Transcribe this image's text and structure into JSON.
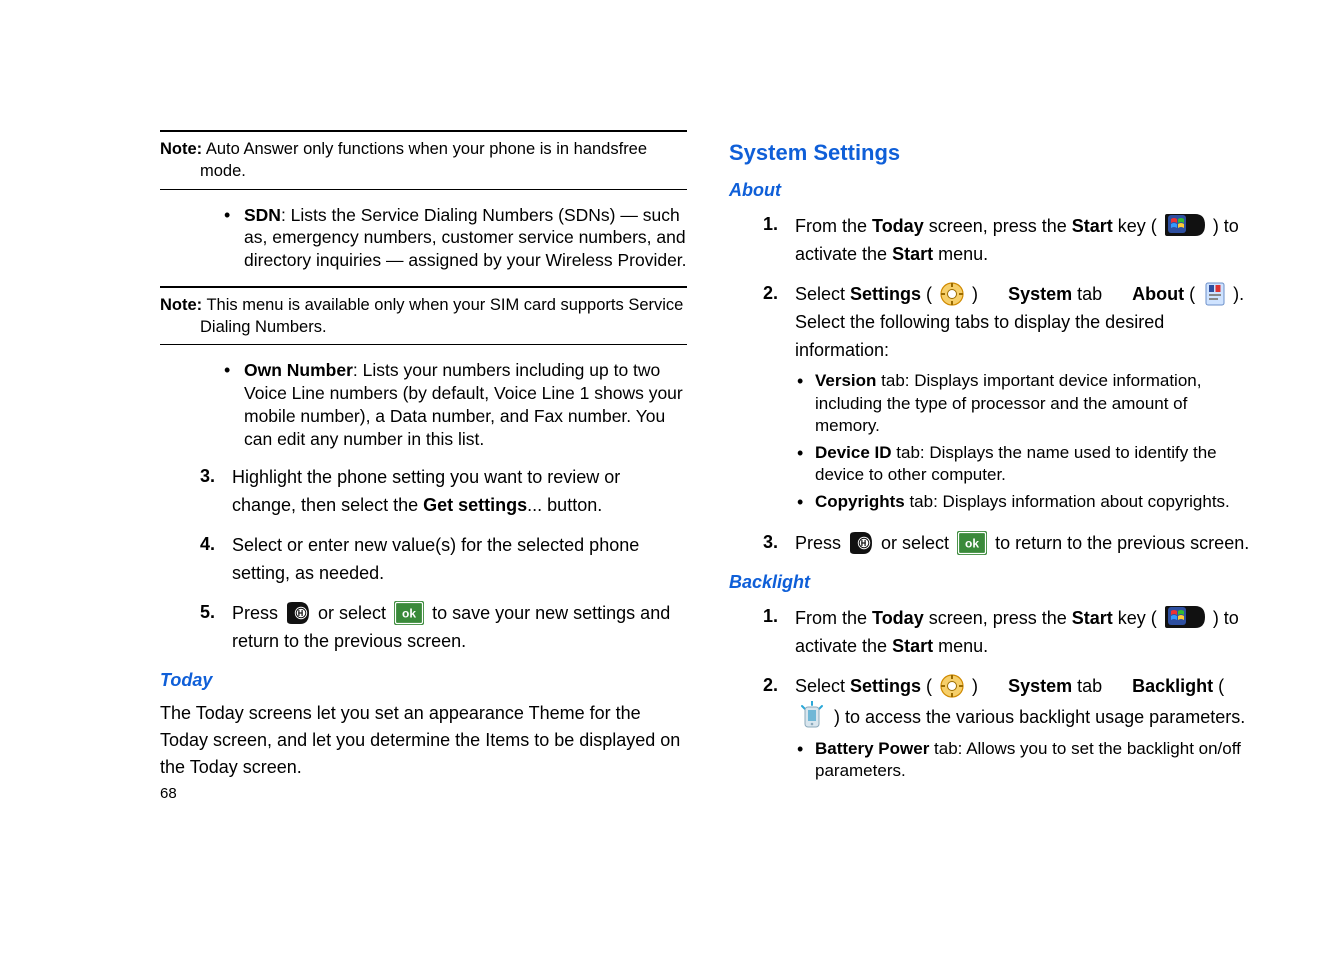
{
  "page_number": "68",
  "left": {
    "note1_label": "Note:",
    "note1_text": " Auto Answer only functions when your phone is in handsfree mode.",
    "bullet_sdn_label": "SDN",
    "bullet_sdn_text": ": Lists the Service Dialing Numbers (SDNs) — such as, emergency numbers, customer service numbers, and directory inquiries — assigned by your Wireless Provider.",
    "note2_label": "Note:",
    "note2_text": " This menu is available only when your SIM card supports Service Dialing Numbers.",
    "bullet_own_label": "Own Number",
    "bullet_own_text": ": Lists your numbers including up to two Voice Line numbers (by default, Voice Line 1 shows your mobile number), a Data number, and Fax number. You can edit any number in this list.",
    "step3_num": "3.",
    "step3_a": "Highlight the phone setting you want to review or change, then select the ",
    "step3_bold": "Get settings",
    "step3_b": "... button.",
    "step4_num": "4.",
    "step4": "Select or enter new value(s) for the selected phone setting, as needed.",
    "step5_num": "5.",
    "step5_a": "Press ",
    "step5_b": " or select ",
    "step5_c": " to save your new settings and return to the previous screen.",
    "today_heading": "Today",
    "today_para": "The Today screens let you set an appearance Theme for the Today screen, and let you determine the Items to be displayed on the Today screen."
  },
  "right": {
    "system_heading": "System Settings",
    "about_heading": "About",
    "a1_num": "1.",
    "a1_a": "From the ",
    "a1_today": "Today",
    "a1_b": " screen, press the ",
    "a1_start": "Start",
    "a1_c": " key ( ",
    "a1_d": " ) to activate the ",
    "a1_startm": "Start",
    "a1_e": " menu.",
    "a2_num": "2.",
    "a2_a": "Select ",
    "a2_settings": "Settings",
    "a2_b": " ( ",
    "a2_c": " )      ",
    "a2_system": "System",
    "a2_d": " tab      ",
    "a2_about": "About",
    "a2_e": " ( ",
    "a2_f": " ). Select the following tabs to display the desired information:",
    "ver_label": "Version",
    "ver_text": " tab: Displays important device information, including the type of processor and the amount of memory.",
    "dev_label": "Device ID",
    "dev_text": " tab: Displays the name used to identify the device to other computer.",
    "cop_label": "Copyrights",
    "cop_text": " tab: Displays information about copyrights.",
    "a3_num": "3.",
    "a3_a": "Press ",
    "a3_b": " or select ",
    "a3_c": " to return to the previous screen.",
    "backlight_heading": "Backlight",
    "b1_num": "1.",
    "b1_a": "From the ",
    "b1_today": "Today",
    "b1_b": " screen, press the ",
    "b1_start": "Start",
    "b1_c": " key ( ",
    "b1_d": " ) to activate the ",
    "b1_startm": "Start",
    "b1_e": " menu.",
    "b2_num": "2.",
    "b2_a": "Select ",
    "b2_settings": "Settings",
    "b2_b": " ( ",
    "b2_c": " )      ",
    "b2_system": "System",
    "b2_d": " tab      ",
    "b2_back": "Backlight",
    "b2_e": " ( ",
    "b2_f": " ) to access the various backlight usage parameters.",
    "bp_label": "Battery Power",
    "bp_text": " tab: Allows you to set the backlight on/off parameters."
  }
}
